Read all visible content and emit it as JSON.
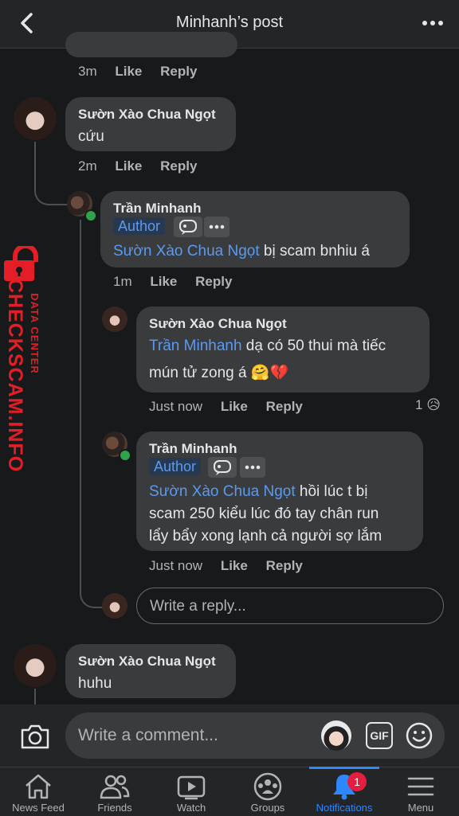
{
  "header": {
    "title": "Minhanh’s post"
  },
  "comments": {
    "c0": {
      "time": "3m",
      "like": "Like",
      "reply": "Reply"
    },
    "c1": {
      "name": "Sườn Xào Chua Ngọt",
      "text": "cứu",
      "time": "2m",
      "like": "Like",
      "reply": "Reply"
    },
    "r1": {
      "name": "Trần Minhanh",
      "badge": "Author",
      "mention": "Sườn Xào Chua Ngọt",
      "text": " bị scam bnhiu á",
      "time": "1m",
      "like": "Like",
      "reply": "Reply"
    },
    "r2": {
      "name": "Sườn Xào Chua Ngọt",
      "mention": "Trần Minhanh",
      "text1": " dạ có 50 thui mà tiếc",
      "text2": "mún tử zong á 🤗💔",
      "time": "Just now",
      "like": "Like",
      "reply": "Reply",
      "reaction_count": "1",
      "reaction_emoji": "😥"
    },
    "r3": {
      "name": "Trần Minhanh",
      "badge": "Author",
      "mention": "Sườn Xào Chua Ngọt",
      "text1": " hồi lúc t bị",
      "text2": "scam 250 kiểu lúc đó tay chân run",
      "text3": "lẩy bẩy xong lạnh cả người sợ lắm",
      "time": "Just now",
      "like": "Like",
      "reply": "Reply"
    },
    "reply_placeholder": "Write a reply...",
    "c2": {
      "name": "Sườn Xào Chua Ngọt",
      "text": "huhu"
    }
  },
  "watermark": {
    "line1": "CHECKSCAM.INFO",
    "line2": "DATA CENTER"
  },
  "composer": {
    "placeholder": "Write a comment...",
    "gif_label": "GIF"
  },
  "nav": {
    "items": [
      {
        "label": "News Feed",
        "icon": "home-icon"
      },
      {
        "label": "Friends",
        "icon": "friends-icon"
      },
      {
        "label": "Watch",
        "icon": "watch-icon"
      },
      {
        "label": "Groups",
        "icon": "groups-icon"
      },
      {
        "label": "Notifications",
        "icon": "bell-icon",
        "badge": "1",
        "active": true
      },
      {
        "label": "Menu",
        "icon": "menu-icon"
      }
    ]
  },
  "colors": {
    "accent": "#2d88ff",
    "mention": "#5a9af0",
    "badge_red": "#e41e3f",
    "watermark": "#e41e26"
  }
}
